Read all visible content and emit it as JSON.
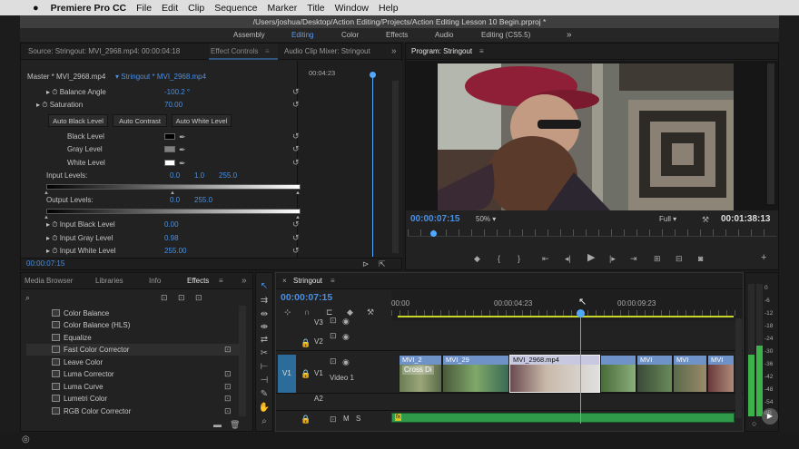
{
  "menubar": {
    "apple": "",
    "app": "Premiere Pro CC",
    "items": [
      "File",
      "Edit",
      "Clip",
      "Sequence",
      "Marker",
      "Title",
      "Window",
      "Help"
    ]
  },
  "window_title": "/Users/joshua/Desktop/Action Editing/Projects/Action Editing Lesson 10 Begin.prproj *",
  "workspaces": {
    "items": [
      "Assembly",
      "Editing",
      "Color",
      "Effects",
      "Audio",
      "Editing (CS5.5)"
    ],
    "active": "Editing",
    "more": "»"
  },
  "source_panel": {
    "tabs": [
      "Source: Stringout: MVI_2968.mp4: 00:00:04:18",
      "Effect Controls",
      "Audio Clip Mixer: Stringout"
    ],
    "active_tab": "Effect Controls",
    "menu_icon": "≡",
    "more": "»",
    "master": "Master * MVI_2968.mp4",
    "sequence_clip": "Stringout * MVI_2968.mp4",
    "ruler_time": "00:04:23",
    "params": [
      {
        "label": "Balance Angle",
        "value": "-100.2 °"
      },
      {
        "label": "Saturation",
        "value": "70.00"
      }
    ],
    "buttons": [
      "Auto Black Level",
      "Auto Contrast",
      "Auto White Level"
    ],
    "levels": [
      {
        "label": "Black Level"
      },
      {
        "label": "Gray Level"
      },
      {
        "label": "White Level"
      }
    ],
    "input_levels": {
      "label": "Input Levels:",
      "values": [
        "0.0",
        "1.0",
        "255.0"
      ]
    },
    "output_levels": {
      "label": "Output Levels:",
      "values": [
        "0.0",
        "255.0"
      ]
    },
    "sub_params": [
      {
        "label": "Input Black Level",
        "value": "0.00"
      },
      {
        "label": "Input Gray Level",
        "value": "0.98"
      },
      {
        "label": "Input White Level",
        "value": "255.00"
      }
    ],
    "timecode": "00:00:07:15"
  },
  "program_panel": {
    "title": "Program: Stringout",
    "menu_icon": "≡",
    "timecode": "00:00:07:15",
    "zoom": "50%",
    "resolution": "Full",
    "duration": "00:01:38:13"
  },
  "effects_panel": {
    "tabs": [
      "Media Browser",
      "Libraries",
      "Info",
      "Effects"
    ],
    "active_tab": "Effects",
    "more": "»",
    "items": [
      "Color Balance",
      "Color Balance (HLS)",
      "Equalize",
      "Fast Color Corrector",
      "Leave Color",
      "Luma Corrector",
      "Luma Curve",
      "Lumetri Color",
      "RGB Color Corrector"
    ],
    "highlighted": "Fast Color Corrector"
  },
  "timeline": {
    "tab": "Stringout",
    "close": "×",
    "menu_icon": "≡",
    "timecode": "00:00:07:15",
    "ruler": [
      "00:00",
      "00:00:04:23",
      "00:00:09:23"
    ],
    "tracks": [
      {
        "name": "V3"
      },
      {
        "name": "V2"
      },
      {
        "name": "V1",
        "label": "Video 1",
        "src": "V1"
      },
      {
        "name": "A2"
      },
      {
        "name": "A1",
        "m": "M",
        "s": "S"
      }
    ],
    "clips": [
      {
        "label": "MVI_2"
      },
      {
        "label": "MVI_29"
      },
      {
        "label": "MVI_2968.mp4"
      },
      {
        "label": "MVI"
      },
      {
        "label": "MVI"
      },
      {
        "label": "MVI"
      }
    ],
    "transition": "Cross Di",
    "fx_badge": "fx"
  },
  "meter": {
    "scale": [
      "0",
      "-6",
      "-12",
      "-18",
      "-24",
      "-30",
      "-36",
      "-42",
      "-48",
      "-54",
      "dB"
    ]
  },
  "colors": {
    "accent": "#4a90e2",
    "active_tab": "#5b9bf3",
    "clip_blue": "#6f93c8",
    "audio_green": "#2f9a4a",
    "playhead": "#4fa9ff"
  }
}
